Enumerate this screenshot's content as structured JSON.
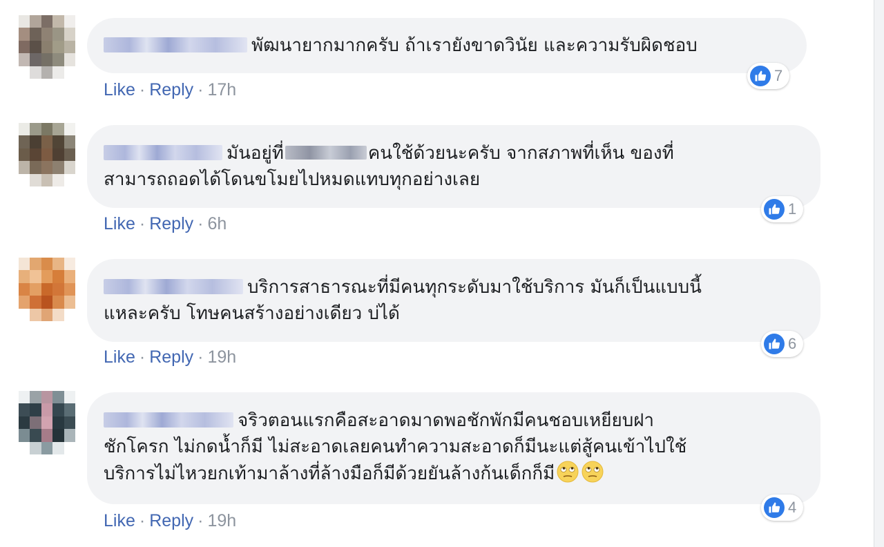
{
  "icons": {
    "like": "thumbs-up-icon",
    "emoji": "rolling-eyes-emoji"
  },
  "colors": {
    "bubble": "#f2f3f5",
    "link": "#4267b2",
    "meta": "#8d949e",
    "like_blue": "#2f7be8"
  },
  "actions": {
    "like": "Like",
    "reply": "Reply",
    "separator": "·"
  },
  "comments": [
    {
      "lines": [
        "พัฒนายากมากครับ ถ้าเรายังขาดวินัย และความรับผิดชอบ"
      ],
      "time": "17h",
      "reaction_count": "7"
    },
    {
      "line1_before": "มันอยู่ที่",
      "line1_after": "คนใช้ด้วยนะครับ จากสภาพที่เห็น ของที่",
      "line2": "สามารถถอดได้โดนขโมยไปหมดแทบทุกอย่างเลย",
      "time": "6h",
      "reaction_count": "1"
    },
    {
      "lines": [
        "บริการสาธารณะที่มีคนทุกระดับมาใช้บริการ มันก็เป็นแบบนี้",
        "แหละครับ โทษคนสร้างอย่างเดียว บ่ได้"
      ],
      "time": "19h",
      "reaction_count": "6"
    },
    {
      "lines": [
        "จริวตอนแรกคือสะอาดมาดพอชักพักมีคนชอบเหยียบฝา",
        "ชักโครก ไม่กดน้ำก็มี ไม่สะอาดเลยคนทำความสะอาดก็มีนะแต่สู้คนเข้าไปใช้",
        "บริการไม่ไหวยกเท้ามาล้างที่ล้างมือก็มีด้วยยันล้างก้นเด็กก็มี"
      ],
      "time": "19h",
      "reaction_count": "4"
    }
  ]
}
